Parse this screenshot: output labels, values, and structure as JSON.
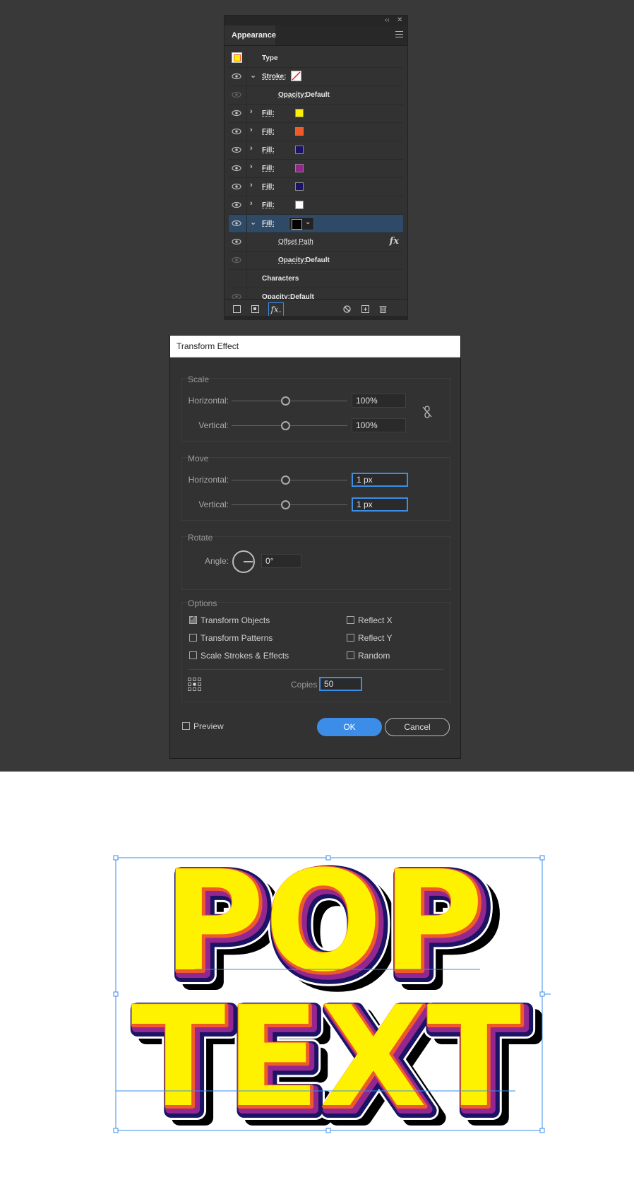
{
  "appearance_panel": {
    "tab_label": "Appearance",
    "rows": [
      {
        "kind": "header",
        "label": "Type"
      },
      {
        "kind": "stroke",
        "label": "Stroke:"
      },
      {
        "kind": "sub",
        "label": "Opacity:",
        "value": "Default"
      },
      {
        "kind": "fill",
        "label": "Fill:",
        "color": "#fff200"
      },
      {
        "kind": "fill",
        "label": "Fill:",
        "color": "#f05a28"
      },
      {
        "kind": "fill",
        "label": "Fill:",
        "color": "#1b1464"
      },
      {
        "kind": "fill",
        "label": "Fill:",
        "color": "#93278f"
      },
      {
        "kind": "fill",
        "label": "Fill:",
        "color": "#1b1464"
      },
      {
        "kind": "fill",
        "label": "Fill:",
        "color": "#ffffff"
      },
      {
        "kind": "fill-open",
        "label": "Fill:",
        "color": "#000000"
      },
      {
        "kind": "effect",
        "label": "Offset Path"
      },
      {
        "kind": "sub",
        "label": "Opacity:",
        "value": "Default"
      },
      {
        "kind": "chars",
        "label": "Characters"
      },
      {
        "kind": "opacity",
        "label": "Opacity:",
        "value": "Default"
      }
    ]
  },
  "transform_dialog": {
    "title": "Transform Effect",
    "scale": {
      "title": "Scale",
      "h_label": "Horizontal:",
      "h_value": "100%",
      "v_label": "Vertical:",
      "v_value": "100%"
    },
    "move": {
      "title": "Move",
      "h_label": "Horizontal:",
      "h_value": "1 px",
      "v_label": "Vertical:",
      "v_value": "1 px"
    },
    "rotate": {
      "title": "Rotate",
      "angle_label": "Angle:",
      "angle_value": "0°"
    },
    "options": {
      "title": "Options",
      "transform_objects": {
        "label": "Transform Objects",
        "checked": true
      },
      "transform_patterns": {
        "label": "Transform Patterns",
        "checked": false
      },
      "scale_strokes": {
        "label": "Scale Strokes & Effects",
        "checked": false
      },
      "reflect_x": {
        "label": "Reflect X",
        "checked": false
      },
      "reflect_y": {
        "label": "Reflect Y",
        "checked": false
      },
      "random": {
        "label": "Random",
        "checked": false
      },
      "copies_label": "Copies",
      "copies_value": "50"
    },
    "preview": {
      "label": "Preview",
      "checked": false
    },
    "ok_label": "OK",
    "cancel_label": "Cancel"
  },
  "artwork": {
    "line1": "POP",
    "line2": "TEXT"
  },
  "colors": {
    "accent": "#3b8de8",
    "yellow": "#fff200",
    "orange": "#f05a28",
    "navy": "#1b1464",
    "purple": "#93278f"
  }
}
